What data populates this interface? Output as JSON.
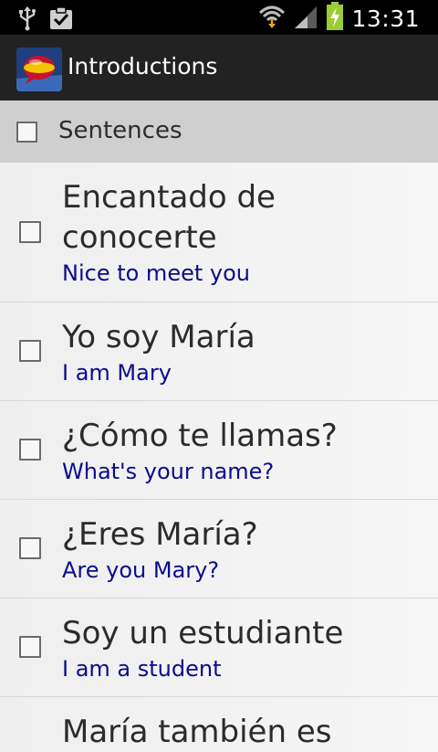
{
  "status_bar": {
    "time": "13:31",
    "icons": [
      "usb-icon",
      "clipboard-check-icon",
      "wifi-icon",
      "signal-icon",
      "battery-charging-icon"
    ],
    "battery_color": "#9acd32"
  },
  "action_bar": {
    "title": "Introductions",
    "logo": "spain-flag-bubble-icon"
  },
  "header": {
    "label": "Sentences"
  },
  "phrases": [
    {
      "spanish": "Encantado de conocerte",
      "english": "Nice to meet you"
    },
    {
      "spanish": "Yo soy María",
      "english": "I am Mary"
    },
    {
      "spanish": "¿Cómo te llamas?",
      "english": "What's your name?"
    },
    {
      "spanish": "¿Eres María?",
      "english": "Are you Mary?"
    },
    {
      "spanish": "Soy un estudiante",
      "english": "I am a student"
    },
    {
      "spanish": "María también es",
      "english": ""
    }
  ],
  "colors": {
    "translation_text": "#0b0c8c",
    "header_bg": "#cfcfcf"
  }
}
